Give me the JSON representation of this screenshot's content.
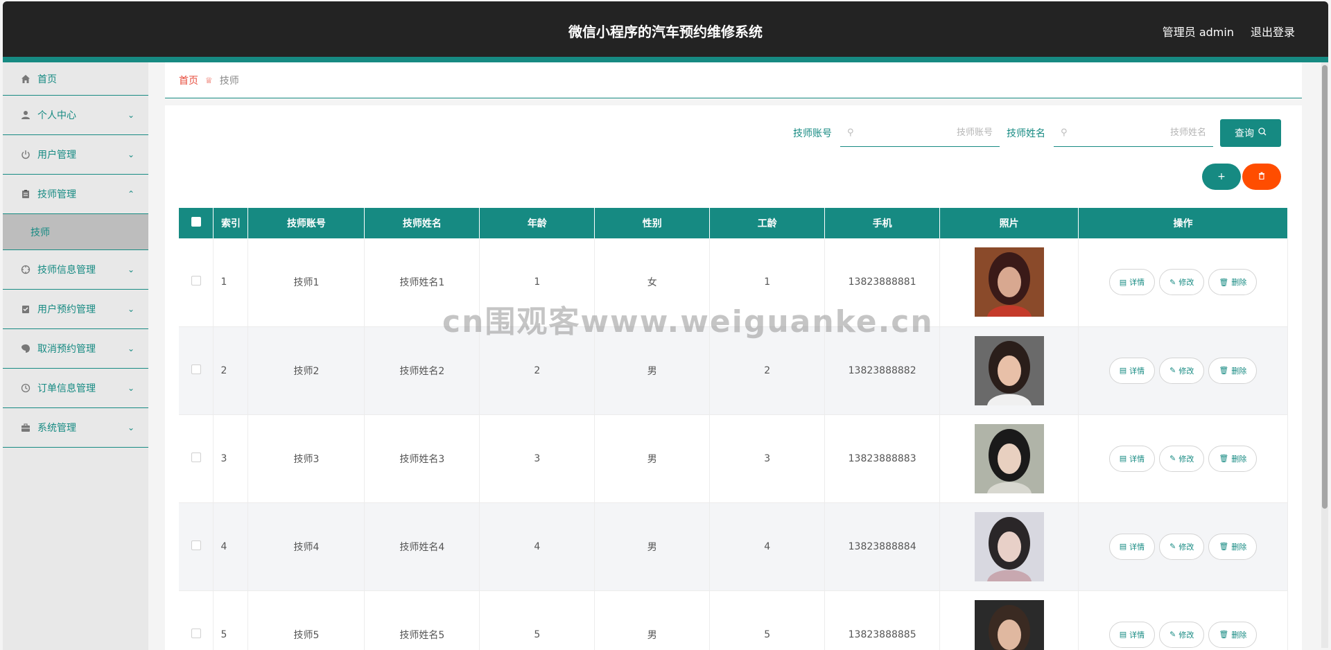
{
  "header": {
    "title": "微信小程序的汽车预约维修系统",
    "user_label": "管理员 admin",
    "logout_label": "退出登录"
  },
  "sidebar": {
    "items": [
      {
        "label": "首页",
        "icon": "home-icon"
      },
      {
        "label": "个人中心",
        "icon": "user-icon"
      },
      {
        "label": "用户管理",
        "icon": "power-icon"
      },
      {
        "label": "技师管理",
        "icon": "clipboard-icon",
        "expanded": true
      },
      {
        "label": "技师信息管理",
        "icon": "crosshair-icon"
      },
      {
        "label": "用户预约管理",
        "icon": "calendar-icon"
      },
      {
        "label": "取消预约管理",
        "icon": "tag-icon"
      },
      {
        "label": "订单信息管理",
        "icon": "clock-icon"
      },
      {
        "label": "系统管理",
        "icon": "briefcase-icon"
      }
    ],
    "submenu": {
      "label": "技师"
    }
  },
  "breadcrumb": {
    "home": "首页",
    "current": "技师"
  },
  "search": {
    "account_label": "技师账号",
    "account_placeholder": "技师账号",
    "name_label": "技师姓名",
    "name_placeholder": "技师姓名",
    "query_label": "查询"
  },
  "buttons": {
    "add": "+",
    "delete_icon": "trash-icon"
  },
  "table": {
    "columns": [
      "索引",
      "技师账号",
      "技师姓名",
      "年龄",
      "性别",
      "工龄",
      "手机",
      "照片",
      "操作"
    ],
    "rows": [
      {
        "index": "1",
        "account": "技师1",
        "name": "技师姓名1",
        "age": "1",
        "gender": "女",
        "years": "1",
        "phone": "13823888881"
      },
      {
        "index": "2",
        "account": "技师2",
        "name": "技师姓名2",
        "age": "2",
        "gender": "男",
        "years": "2",
        "phone": "13823888882"
      },
      {
        "index": "3",
        "account": "技师3",
        "name": "技师姓名3",
        "age": "3",
        "gender": "男",
        "years": "3",
        "phone": "13823888883"
      },
      {
        "index": "4",
        "account": "技师4",
        "name": "技师姓名4",
        "age": "4",
        "gender": "男",
        "years": "4",
        "phone": "13823888884"
      },
      {
        "index": "5",
        "account": "技师5",
        "name": "技师姓名5",
        "age": "5",
        "gender": "男",
        "years": "5",
        "phone": "13823888885"
      }
    ],
    "actions": {
      "detail": "详情",
      "edit": "修改",
      "delete": "删除"
    }
  },
  "watermark": "cn围观客www.weiguanke.cn",
  "colors": {
    "primary": "#168a82",
    "danger": "#ff4d00",
    "header_bg": "#232323"
  }
}
